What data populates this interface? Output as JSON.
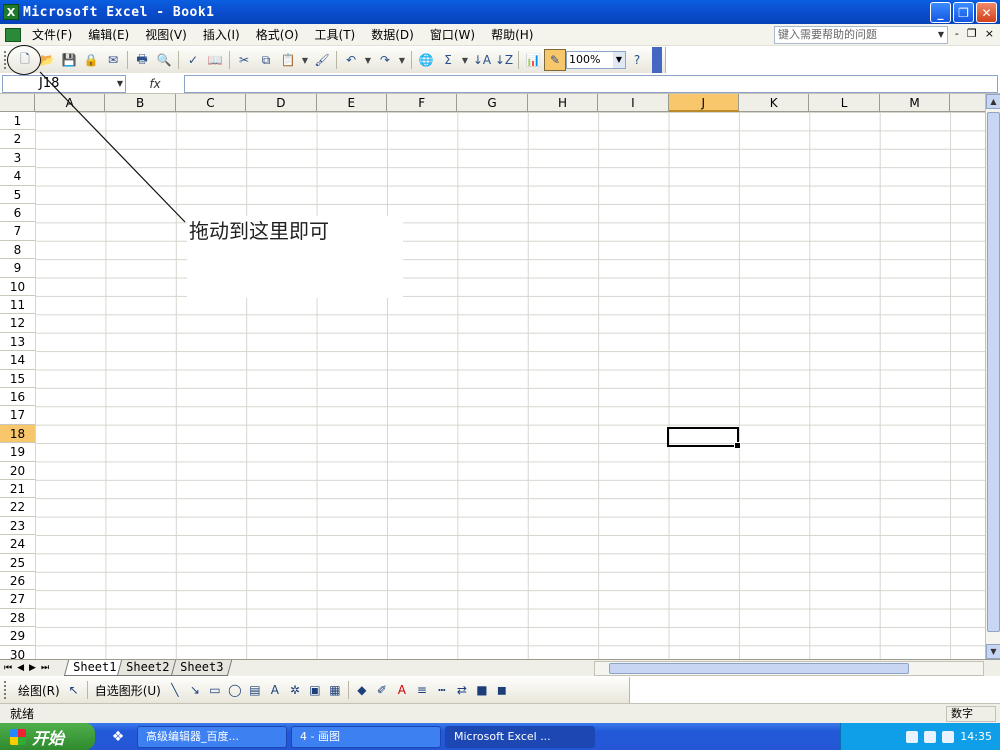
{
  "window": {
    "title": "Microsoft Excel - Book1",
    "app_icon": "X",
    "btn_min": "_",
    "btn_max": "❐",
    "btn_close": "✕"
  },
  "menu": {
    "items": [
      "文件(F)",
      "编辑(E)",
      "视图(V)",
      "插入(I)",
      "格式(O)",
      "工具(T)",
      "数据(D)",
      "窗口(W)",
      "帮助(H)"
    ],
    "help_placeholder": "键入需要帮助的问题",
    "mdi_min": "-",
    "mdi_restore": "❐",
    "mdi_close": "×"
  },
  "toolbar": {
    "zoom": "100%"
  },
  "formula_bar": {
    "name_box": "J18",
    "fx": "fx"
  },
  "grid": {
    "columns": [
      "A",
      "B",
      "C",
      "D",
      "E",
      "F",
      "G",
      "H",
      "I",
      "J",
      "K",
      "L",
      "M",
      ""
    ],
    "rows": [
      "1",
      "2",
      "3",
      "4",
      "5",
      "6",
      "7",
      "8",
      "9",
      "10",
      "11",
      "12",
      "13",
      "14",
      "15",
      "16",
      "17",
      "18",
      "19",
      "20",
      "21",
      "22",
      "23",
      "24",
      "25",
      "26",
      "27",
      "28",
      "29",
      "30"
    ],
    "selected_column": "J",
    "selected_row": "18"
  },
  "annotation": {
    "text": "拖动到这里即可"
  },
  "sheets": {
    "tabs": [
      "Sheet1",
      "Sheet2",
      "Sheet3"
    ],
    "active": "Sheet1"
  },
  "draw_toolbar": {
    "draw_label": "绘图(R)",
    "autoshapes_label": "自选图形(U)"
  },
  "status": {
    "left": "就绪",
    "right": "数字"
  },
  "taskbar": {
    "start": "开始",
    "tasks": [
      "高级编辑器_百度...",
      "4 - 画图",
      "Microsoft Excel ..."
    ],
    "clock": "14:35"
  }
}
